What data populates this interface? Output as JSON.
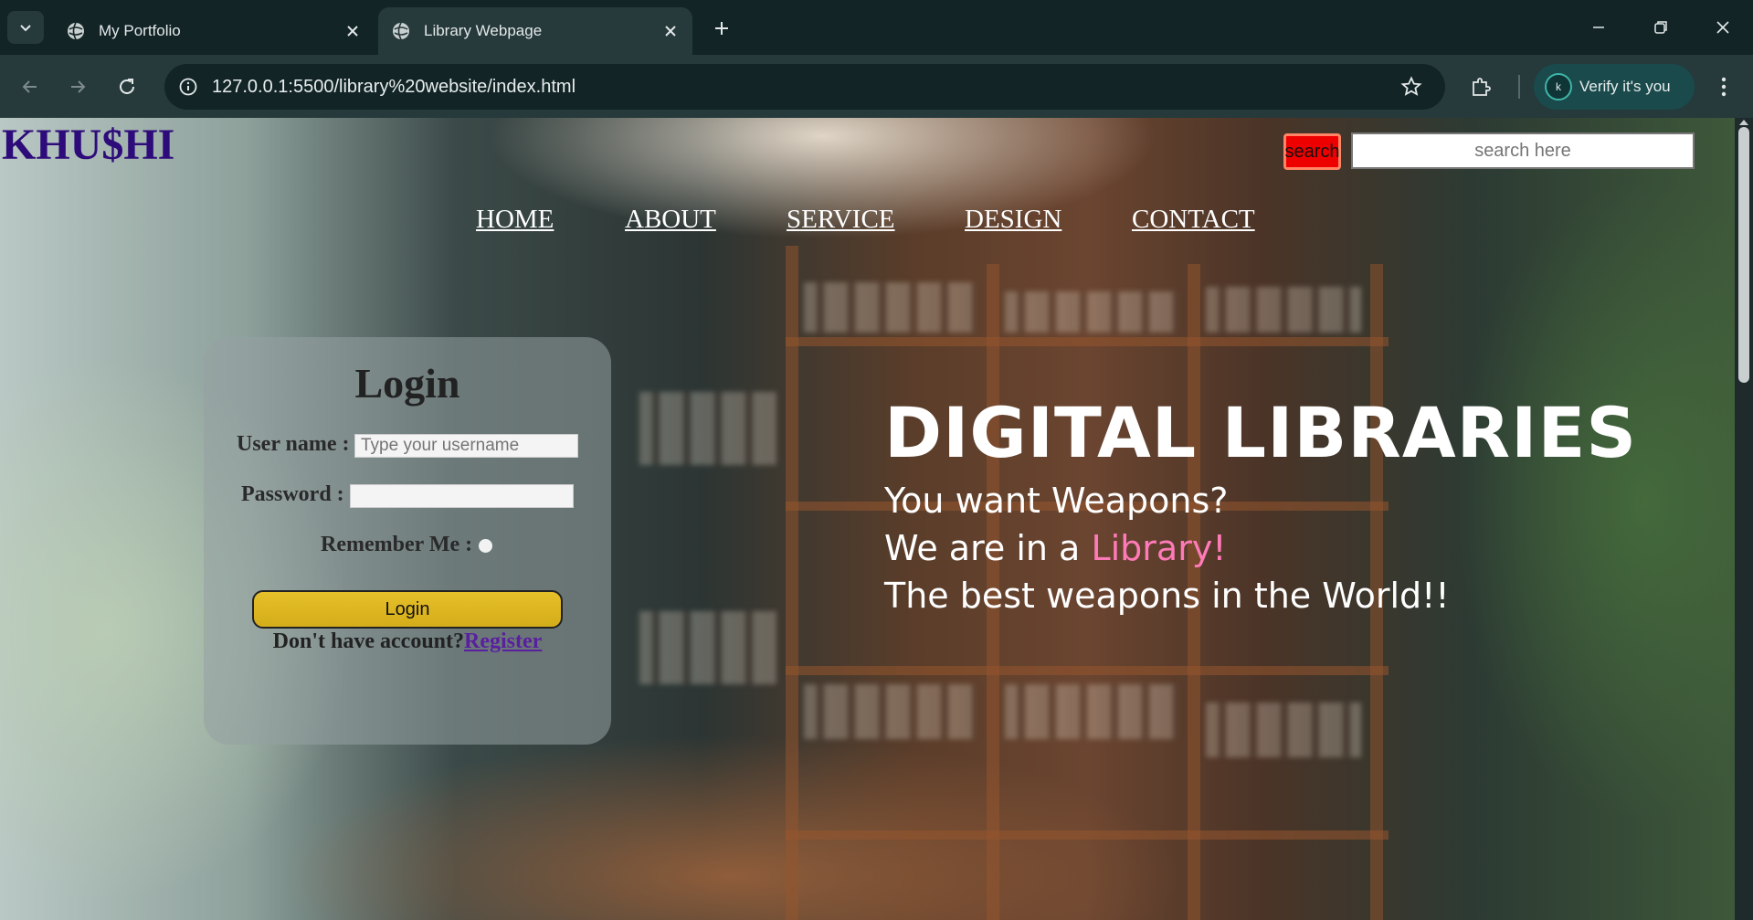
{
  "browser": {
    "tabs": [
      {
        "title": "My Portfolio",
        "active": false
      },
      {
        "title": "Library Webpage",
        "active": true
      }
    ],
    "url": "127.0.0.1:5500/library%20website/index.html",
    "profile_label": "Verify it's you",
    "profile_initial": "k"
  },
  "page": {
    "logo": "KHU$HI",
    "search_button": "search",
    "search_placeholder": "search here",
    "nav": [
      "HOME",
      "ABOUT",
      "SERVICE",
      "DESIGN",
      "CONTACT"
    ],
    "login": {
      "title": "Login",
      "username_label": "User name :",
      "username_placeholder": "Type your username",
      "password_label": "Password :",
      "remember_label": "Remember Me :",
      "button": "Login",
      "no_account": "Don't have account?",
      "register": "Register"
    },
    "hero": {
      "title": "DIGITAL LIBRARIES",
      "line1": "You want Weapons?",
      "line2_prefix": "We are in a ",
      "line2_highlight": "Library!",
      "line3": "The best weapons in the World!!"
    }
  },
  "colors": {
    "logo": "#2d0b7a",
    "highlight": "#ff7ab8",
    "search_button": "#ee0000",
    "login_button": "#e0b820"
  }
}
